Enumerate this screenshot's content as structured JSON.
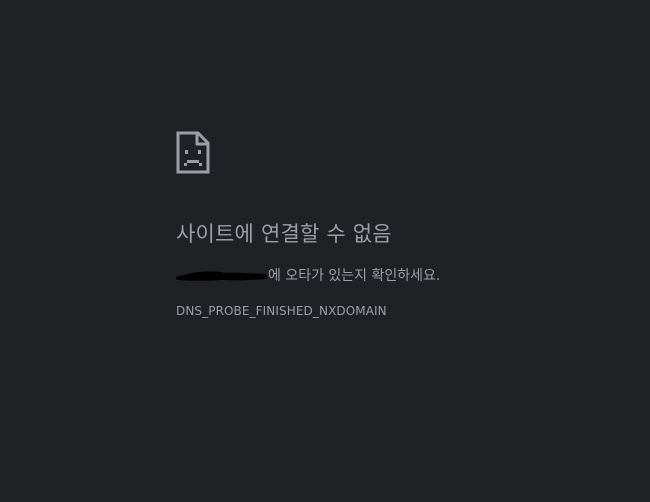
{
  "error_page": {
    "icon": "sad-page-icon",
    "title": "사이트에 연결할 수 없음",
    "message_suffix": "에 오타가 있는지 확인하세요.",
    "error_code": "DNS_PROBE_FINISHED_NXDOMAIN"
  },
  "colors": {
    "background": "#202124",
    "text": "#9aa0a6",
    "redaction": "#000000"
  }
}
